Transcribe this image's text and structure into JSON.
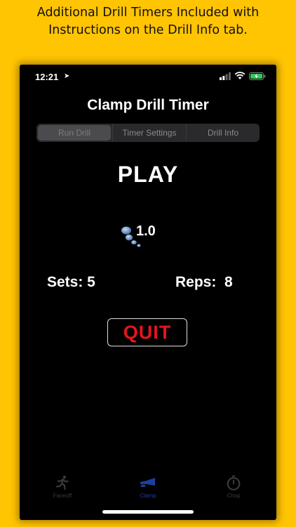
{
  "caption": {
    "line1": "Additional Drill Timers Included with",
    "line2": "Instructions on the Drill Info tab."
  },
  "status_bar": {
    "time": "12:21",
    "location_glyph": "➤"
  },
  "screen": {
    "title": "Clamp Drill Timer",
    "segments": [
      {
        "label": "Run Drill",
        "selected": true
      },
      {
        "label": "Timer Settings",
        "selected": false
      },
      {
        "label": "Drill Info",
        "selected": false
      }
    ],
    "play_label": "PLAY",
    "timer_value": "1.0",
    "sets_label": "Sets: 5",
    "reps_label": "Reps:  8",
    "quit_label": "QUIT"
  },
  "tabbar": {
    "items": [
      {
        "label": "Faceoff",
        "icon": "running-person-icon",
        "active": false
      },
      {
        "label": "Clamp",
        "icon": "clamp-icon",
        "active": true
      },
      {
        "label": "Chop",
        "icon": "stopwatch-icon",
        "active": false
      }
    ]
  },
  "colors": {
    "background": "#FFC402",
    "quit_text": "#E8141C",
    "active_tab": "#1E3FA0",
    "inactive_tab": "#3a3a3c"
  }
}
